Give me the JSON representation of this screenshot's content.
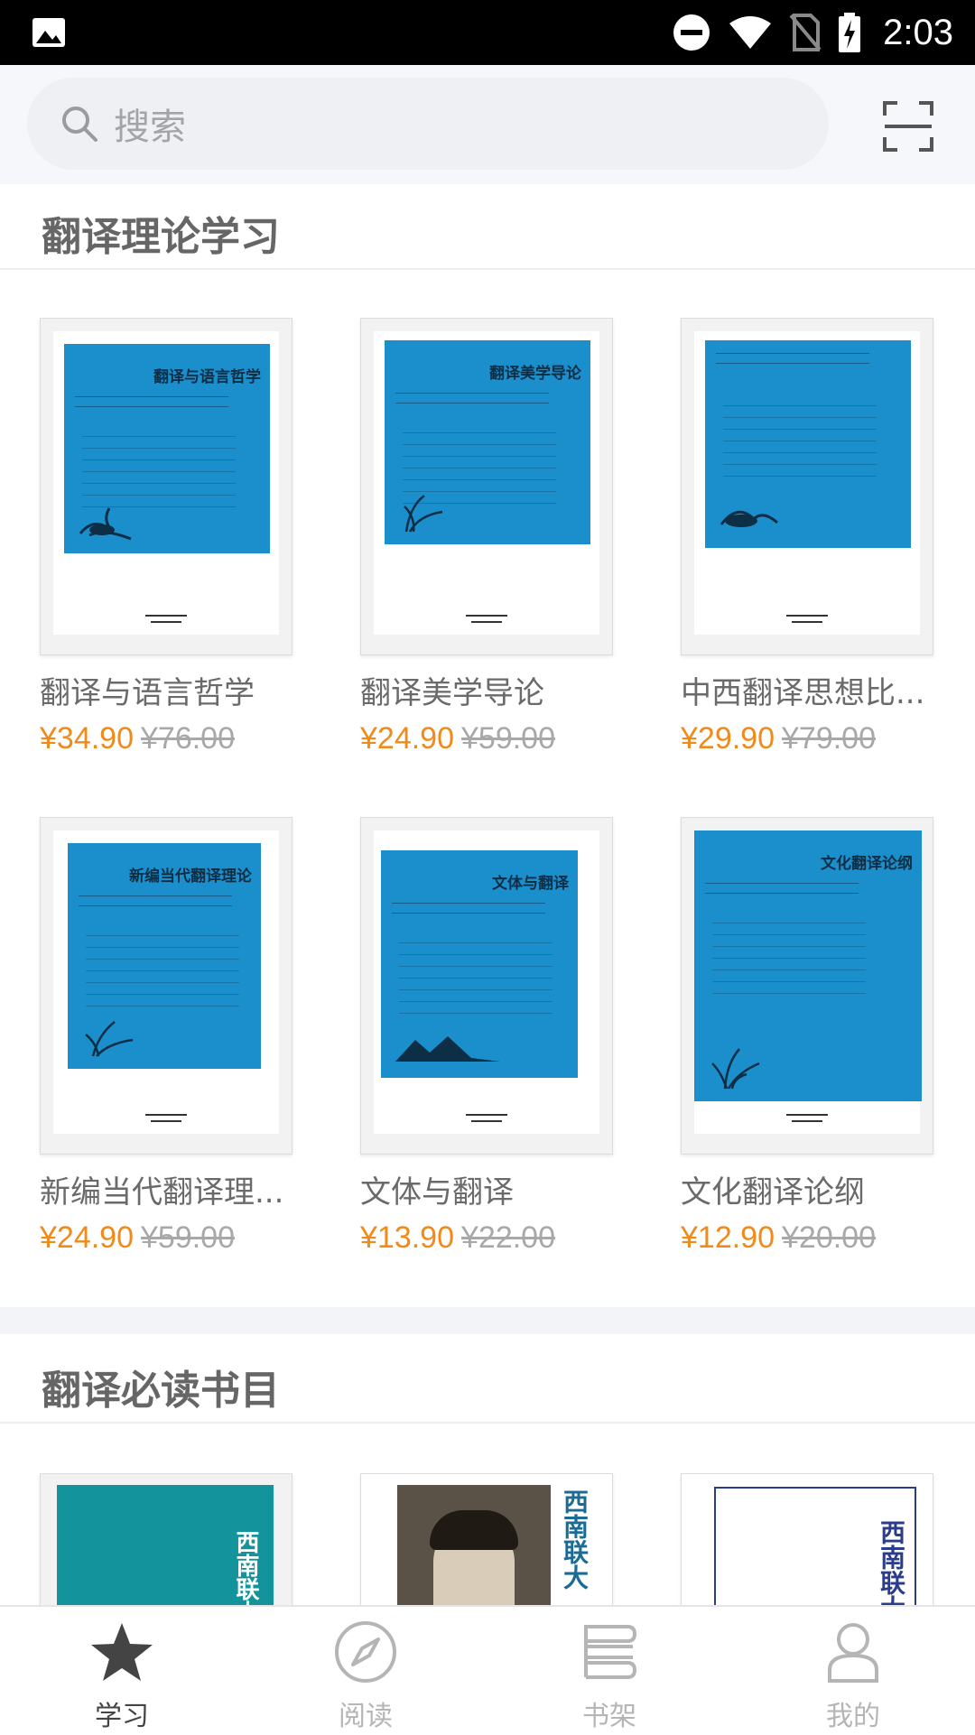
{
  "status_bar": {
    "time": "2:03",
    "icons": [
      "image-icon",
      "do-not-disturb-icon",
      "wifi-icon",
      "no-sim-icon",
      "battery-charging-icon"
    ]
  },
  "search": {
    "placeholder": "搜索",
    "scan_icon": "scan-icon"
  },
  "sections": [
    {
      "title": "翻译理论学习",
      "books": [
        {
          "name": "翻译与语言哲学",
          "price": "¥34.90",
          "original_price": "¥76.00",
          "cover_title": "翻译与语言哲学"
        },
        {
          "name": "翻译美学导论",
          "price": "¥24.90",
          "original_price": "¥59.00",
          "cover_title": "翻译美学导论"
        },
        {
          "name": "中西翻译思想比...",
          "price": "¥29.90",
          "original_price": "¥79.00",
          "cover_title": ""
        },
        {
          "name": "新编当代翻译理...",
          "price": "¥24.90",
          "original_price": "¥59.00",
          "cover_title": "新编当代翻译理论"
        },
        {
          "name": "文体与翻译",
          "price": "¥13.90",
          "original_price": "¥22.00",
          "cover_title": "文体与翻译"
        },
        {
          "name": "文化翻译论纲",
          "price": "¥12.90",
          "original_price": "¥20.00",
          "cover_title": "文化翻译论纲"
        }
      ]
    },
    {
      "title": "翻译必读书目",
      "books": [
        {
          "cover_title": "西南联大"
        },
        {
          "cover_title": "西南联大"
        },
        {
          "cover_title": "西南联大"
        }
      ]
    }
  ],
  "bottom_nav": [
    {
      "label": "学习",
      "icon": "star-icon",
      "active": true
    },
    {
      "label": "阅读",
      "icon": "compass-icon",
      "active": false
    },
    {
      "label": "书架",
      "icon": "bookshelf-icon",
      "active": false
    },
    {
      "label": "我的",
      "icon": "person-icon",
      "active": false
    }
  ],
  "colors": {
    "accent_price": "#f08a1a",
    "cover_blue": "#1b8fcc",
    "cover_teal": "#13949c"
  }
}
